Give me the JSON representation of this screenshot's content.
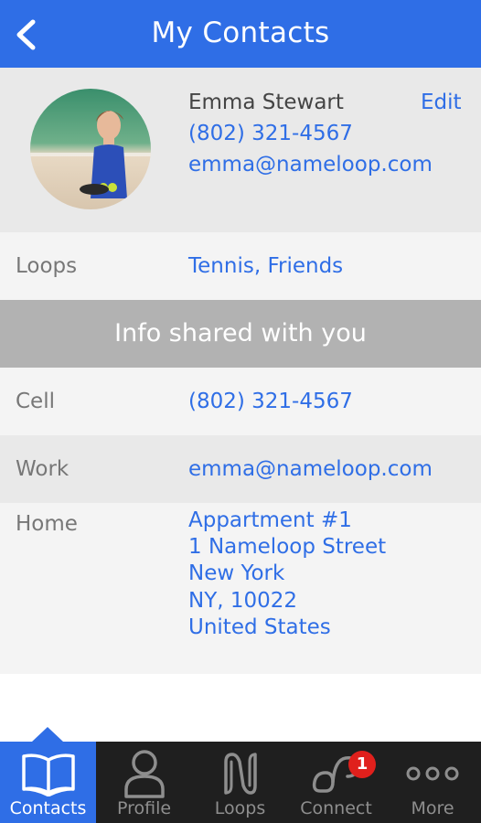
{
  "header": {
    "title": "My Contacts"
  },
  "contact": {
    "name": "Emma Stewart",
    "phone": "(802) 321-4567",
    "email": "emma@nameloop.com",
    "edit_label": "Edit"
  },
  "loops": {
    "label": "Loops",
    "value": "Tennis, Friends"
  },
  "section": {
    "title": "Info shared with you"
  },
  "fields": {
    "cell": {
      "label": "Cell",
      "value": "(802) 321-4567"
    },
    "work": {
      "label": "Work",
      "value": "emma@nameloop.com"
    },
    "home": {
      "label": "Home",
      "lines": [
        "Appartment #1",
        "1 Nameloop Street",
        "New York",
        "NY, 10022",
        "United States"
      ]
    }
  },
  "tabs": [
    {
      "label": "Contacts",
      "icon": "book-icon",
      "active": true
    },
    {
      "label": "Profile",
      "icon": "person-icon",
      "active": false
    },
    {
      "label": "Loops",
      "icon": "loops-logo-icon",
      "active": false
    },
    {
      "label": "Connect",
      "icon": "connect-icon",
      "active": false,
      "badge": "1"
    },
    {
      "label": "More",
      "icon": "more-dots-icon",
      "active": false
    }
  ],
  "colors": {
    "accent": "#2f6ee6",
    "tabbar": "#1f1f1f",
    "section": "#b2b2b2",
    "badge": "#e0201c"
  }
}
